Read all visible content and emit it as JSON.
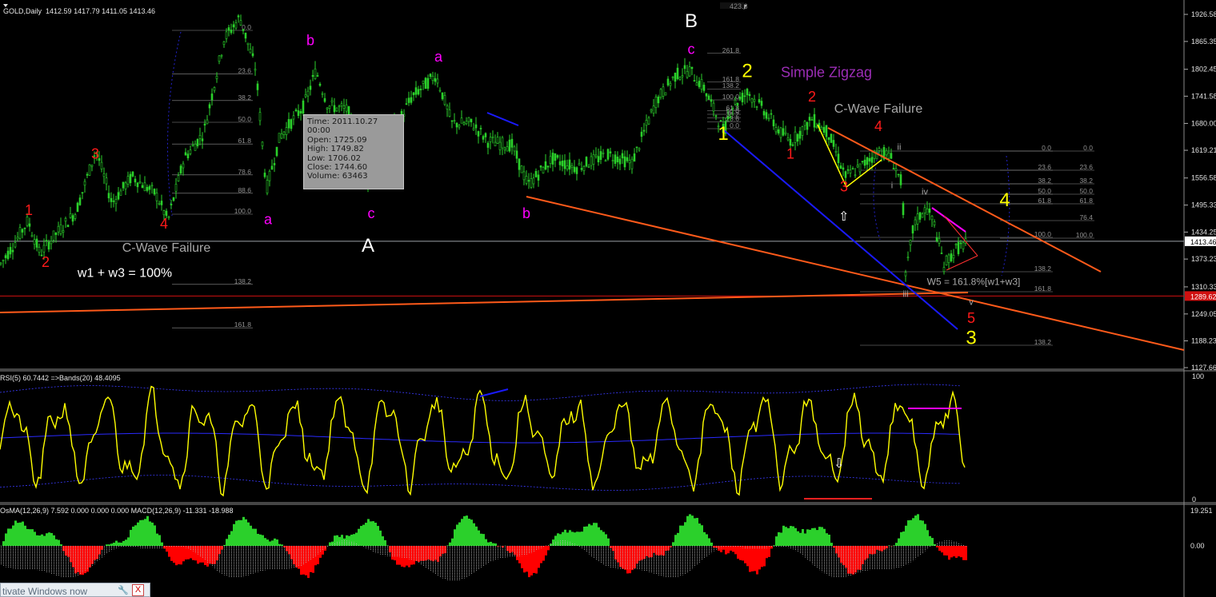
{
  "header": {
    "symbol": "GOLD,Daily",
    "ohlc": "1412.59 1417.79 1411.05 1413.46",
    "rsi": "RSI(5) 60.7442 =>Bands(20) 48.4095",
    "osma": "OsMA(12,26,9) 7.592 0.000 0.000 0.000  MACD(12,26,9) -11.331 -18.988"
  },
  "tooltip": {
    "time": "Time: 2011.10.27 00:00",
    "open": "Open: 1725.09",
    "high": "High: 1749.82",
    "low": "Low: 1706.02",
    "close": "Close: 1744.60",
    "volume": "Volume: 63463"
  },
  "taskbar": {
    "text": "tivate Windows now",
    "close": "X",
    "icon": "wrench-icon"
  },
  "colors": {
    "candle": "#2bd02b",
    "rsi": "#ffff00",
    "red": "#ff0000",
    "magenta": "#ff00ff",
    "yellow": "#ffff00",
    "white": "#ffffff",
    "orange": "#ff5a1a",
    "blue": "#1a1aff",
    "osma_up": "#2bd02b",
    "osma_down": "#ff0000",
    "macd": "#c0c0c0",
    "fib": "#909090"
  },
  "chart_data": [
    {
      "type": "candlestick",
      "title": "GOLD,Daily",
      "ylim": [
        1127.66,
        1926.58
      ],
      "y_ticks": [
        "1926.58",
        "1865.35",
        "1802.45",
        "1741.58",
        "1680.00",
        "1619.21",
        "1556.58",
        "1495.33",
        "1434.25",
        "1413.46",
        "1373.23",
        "1310.33",
        "1289.62",
        "1249.05",
        "1188.23",
        "1127.66"
      ],
      "current_price": "1413.46",
      "support_price": "1289.62",
      "top_marker": "423.6",
      "price_path": [
        [
          0,
          1360
        ],
        [
          15,
          1400
        ],
        [
          35,
          1460
        ],
        [
          50,
          1385
        ],
        [
          70,
          1430
        ],
        [
          95,
          1480
        ],
        [
          120,
          1620
        ],
        [
          140,
          1500
        ],
        [
          165,
          1560
        ],
        [
          195,
          1520
        ],
        [
          210,
          1460
        ],
        [
          230,
          1600
        ],
        [
          255,
          1660
        ],
        [
          280,
          1870
        ],
        [
          300,
          1920
        ],
        [
          320,
          1800
        ],
        [
          333,
          1530
        ],
        [
          350,
          1650
        ],
        [
          380,
          1720
        ],
        [
          395,
          1800
        ],
        [
          410,
          1720
        ],
        [
          435,
          1710
        ],
        [
          462,
          1540
        ],
        [
          480,
          1660
        ],
        [
          500,
          1690
        ],
        [
          515,
          1740
        ],
        [
          545,
          1790
        ],
        [
          565,
          1680
        ],
        [
          590,
          1680
        ],
        [
          610,
          1640
        ],
        [
          640,
          1630
        ],
        [
          660,
          1540
        ],
        [
          690,
          1600
        ],
        [
          720,
          1580
        ],
        [
          760,
          1610
        ],
        [
          790,
          1590
        ],
        [
          820,
          1730
        ],
        [
          845,
          1790
        ],
        [
          862,
          1800
        ],
        [
          880,
          1760
        ],
        [
          895,
          1700
        ],
        [
          905,
          1660
        ],
        [
          915,
          1720
        ],
        [
          935,
          1750
        ],
        [
          955,
          1710
        ],
        [
          975,
          1660
        ],
        [
          990,
          1640
        ],
        [
          1015,
          1690
        ],
        [
          1035,
          1660
        ],
        [
          1057,
          1560
        ],
        [
          1075,
          1580
        ],
        [
          1100,
          1620
        ],
        [
          1115,
          1600
        ],
        [
          1128,
          1540
        ],
        [
          1132,
          1330
        ],
        [
          1142,
          1450
        ],
        [
          1158,
          1490
        ],
        [
          1168,
          1450
        ],
        [
          1180,
          1360
        ],
        [
          1195,
          1395
        ],
        [
          1208,
          1410
        ]
      ],
      "wave_labels": [
        {
          "text": "1",
          "color": "red",
          "price": 1473,
          "bar": 36
        },
        {
          "text": "2",
          "color": "red",
          "price": 1355,
          "bar": 57
        },
        {
          "text": "3",
          "color": "red",
          "price": 1600,
          "bar": 119
        },
        {
          "text": "4",
          "color": "red",
          "price": 1442,
          "bar": 205
        },
        {
          "text": "C-Wave Failure",
          "color": "gray",
          "price": 1390,
          "bar": 208
        },
        {
          "text": "w1 + w3 = 100%",
          "color": "white",
          "price": 1333,
          "bar": 156
        },
        {
          "text": "a",
          "color": "magenta",
          "price": 1452,
          "bar": 335
        },
        {
          "text": "b",
          "color": "magenta",
          "price": 1857,
          "bar": 388
        },
        {
          "text": "c",
          "color": "magenta",
          "price": 1466,
          "bar": 464
        },
        {
          "text": "A",
          "color": "white",
          "price": 1390,
          "bar": 460
        },
        {
          "text": "a",
          "color": "magenta",
          "price": 1820,
          "bar": 548
        },
        {
          "text": "b",
          "color": "magenta",
          "price": 1466,
          "bar": 658
        },
        {
          "text": "B",
          "color": "white",
          "price": 1898,
          "bar": 864
        },
        {
          "text": "c",
          "color": "magenta",
          "price": 1837,
          "bar": 864
        },
        {
          "text": "1",
          "color": "yellow",
          "price": 1643,
          "bar": 904
        },
        {
          "text": "2",
          "color": "yellow",
          "price": 1785,
          "bar": 934
        },
        {
          "text": "Simple Zigzag",
          "color": "purple",
          "price": 1785,
          "bar": 1033
        },
        {
          "text": "2",
          "color": "red",
          "price": 1730,
          "bar": 1015
        },
        {
          "text": "C-Wave Failure",
          "color": "gray",
          "price": 1704,
          "bar": 1098
        },
        {
          "text": "4",
          "color": "red",
          "price": 1663,
          "bar": 1098
        },
        {
          "text": "1",
          "color": "red",
          "price": 1600,
          "bar": 988
        },
        {
          "text": "3",
          "color": "red",
          "price": 1526,
          "bar": 1055
        },
        {
          "text": "i",
          "color": "gray",
          "price": 1533,
          "bar": 1115
        },
        {
          "text": "ii",
          "color": "gray",
          "price": 1620,
          "bar": 1124
        },
        {
          "text": "iv",
          "color": "gray",
          "price": 1519,
          "bar": 1156
        },
        {
          "text": "4",
          "color": "yellow",
          "price": 1493,
          "bar": 1256
        },
        {
          "text": "W5 = 161.8%[w1+w3]",
          "color": "gray",
          "price": 1315,
          "bar": 1217
        },
        {
          "text": "iii",
          "color": "gray",
          "price": 1288,
          "bar": 1132
        },
        {
          "text": "v",
          "color": "gray",
          "price": 1270,
          "bar": 1214
        },
        {
          "text": "5",
          "color": "red",
          "price": 1229,
          "bar": 1214
        },
        {
          "text": "3",
          "color": "yellow",
          "price": 1181,
          "bar": 1214
        }
      ],
      "fib_left": [
        "0.0",
        "23.6",
        "38.2",
        "50.0",
        "61.8",
        "78.6",
        "88.6",
        "100.0",
        "138.2",
        "161.8"
      ],
      "fib_mid": [
        "261.8",
        "161.8",
        "138.2",
        "100.0",
        "61.8",
        "50.0",
        "38.2",
        "23.6",
        "0.0"
      ],
      "fib_right_a": [
        "0.0",
        "23.6",
        "38.2",
        "50.0",
        "61.8",
        "100.0",
        "138.2",
        "161.8",
        "138.2"
      ],
      "fib_right_b": [
        "0.0",
        "23.6",
        "38.2",
        "50.0",
        "61.8",
        "76.4",
        "100.0"
      ]
    },
    {
      "type": "line",
      "title": "RSI(5) 60.7442 =>Bands(20) 48.4095",
      "ylim": [
        0,
        100
      ],
      "y_ticks": [
        "100",
        "0"
      ]
    },
    {
      "type": "bar",
      "title": "OsMA(12,26,9) 7.592 0.000 0.000 0.000  MACD(12,26,9) -11.331 -18.988",
      "y_ticks": [
        "19.251",
        "0.00"
      ]
    }
  ]
}
